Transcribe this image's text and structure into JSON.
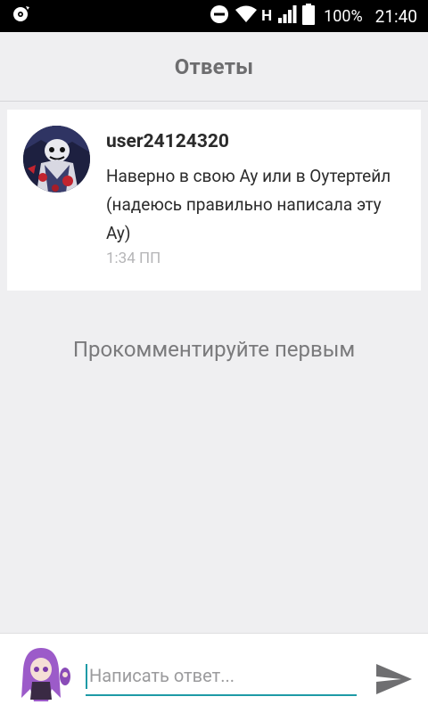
{
  "status_bar": {
    "network_type": "H",
    "battery_percent": "100%",
    "time": "21:40"
  },
  "header": {
    "title": "Ответы"
  },
  "comment": {
    "username": "user24124320",
    "text": "Наверно в свою Ау или в Оутертейл (надеюсь правильно написала эту Ау)",
    "time": "1:34 ПП"
  },
  "empty_state": {
    "message": "Прокомментируйте первым"
  },
  "composer": {
    "placeholder": "Написать ответ...",
    "value": ""
  },
  "icons": {
    "status_left": "media-sync-icon",
    "dnd": "do-not-disturb-icon",
    "wifi": "wifi-icon",
    "signal": "cellular-signal-icon",
    "battery": "battery-icon",
    "send": "send-icon"
  },
  "colors": {
    "accent": "#1e9aa6",
    "background": "#efeff1",
    "title": "#6d6d6f",
    "timestamp": "#b5b5b7"
  }
}
